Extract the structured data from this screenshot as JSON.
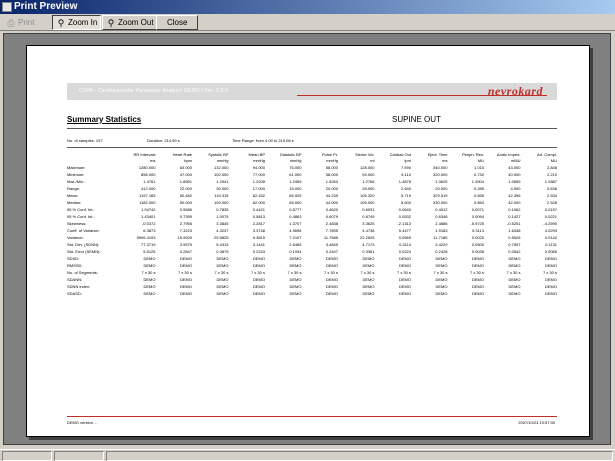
{
  "window": {
    "title": "Print Preview"
  },
  "toolbar": {
    "print_label": "Print",
    "zoom_in_label": "Zoom In",
    "zoom_out_label": "Zoom Out",
    "close_label": "Close"
  },
  "report": {
    "banner_title": "CVPA - Cardiovascular Parameter Analysis DEMO / Ver. 2.0.0",
    "logo_text": "nevrokard",
    "section_title": "Summary Statistics",
    "position_label": "SUPINE OUT",
    "samples_label": "No. of samples:",
    "samples_value": "197",
    "duration_label": "Duration:",
    "duration_value": "214.99 s",
    "time_range_label": "Time Range:",
    "time_range_value": "from 4.09 to 219.08 s",
    "footer_left": "DEMO version ...",
    "footer_right": "2007/10/23 19:57:30",
    "columns": [
      {
        "name": "RR Intervals",
        "unit": "ms"
      },
      {
        "name": "Heart Rate",
        "unit": "bpm"
      },
      {
        "name": "Systolic BP",
        "unit": "mmHg"
      },
      {
        "name": "Mean BP",
        "unit": "mmHg"
      },
      {
        "name": "Diastolic BP",
        "unit": "mmHg"
      },
      {
        "name": "Pulse Pr.",
        "unit": "mmHg"
      },
      {
        "name": "Stroke Vol.",
        "unit": "ml"
      },
      {
        "name": "Cardiac Out",
        "unit": "lpm"
      },
      {
        "name": "Eject. Time",
        "unit": "ms"
      },
      {
        "name": "Periph. Res.",
        "unit": "MU"
      },
      {
        "name": "Aortic Imped.",
        "unit": "mMU"
      },
      {
        "name": "Art. Compl.",
        "unit": "MU"
      }
    ],
    "rows": [
      {
        "label": "Maximum:",
        "values": [
          "1280.000",
          "83.000",
          "132.000",
          "94.000",
          "76.000",
          "58.000",
          "128.000",
          "7.590",
          "340.000",
          "1.015",
          "43.000",
          "2.848"
        ]
      },
      {
        "label": "Minimum:",
        "values": [
          "856.000",
          "47.000",
          "102.000",
          "77.000",
          "61.000",
          "38.000",
          "94.000",
          "5.110",
          "320.000",
          "0.730",
          "40.000",
          "2.210"
        ]
      },
      {
        "label": "Max./Min.:",
        "values": [
          "1.4761",
          "1.8951",
          "1.2941",
          "1.2208",
          "1.2459",
          "1.5263",
          "1.2766",
          "1.4878",
          "1.0625",
          "1.3904",
          "1.0659",
          "1.2887"
        ]
      },
      {
        "label": "Range:",
        "values": [
          "412.000",
          "22.000",
          "30.000",
          "17.000",
          "15.000",
          "20.000",
          "28.000",
          "2.640",
          "20.000",
          "0.285",
          "4.000",
          "0.638"
        ]
      },
      {
        "label": "Mean:",
        "values": [
          "1197.165",
          "50.482",
          "119.315",
          "82.432",
          "65.925",
          "44.239",
          "105.320",
          "5.719",
          "329.519",
          "0.855",
          "42.396",
          "2.534"
        ]
      },
      {
        "label": "Median:",
        "values": [
          "1182.000",
          "50.000",
          "109.000",
          "82.000",
          "65.000",
          "44.000",
          "105.000",
          "5.600",
          "330.000",
          "0.854",
          "42.000",
          "2.528"
        ]
      },
      {
        "label": "95 % Conf. Int.:",
        "values": [
          "1.94742",
          "0.5586",
          "0.7835",
          "0.4421",
          "0.5777",
          "0.4620",
          "0.6031",
          "0.0640",
          "0.4012",
          "0.0071",
          "0.1062",
          "0.0157"
        ]
      },
      {
        "label": "95 % Conf. Int.:",
        "values": [
          "1.43401",
          "0.7395",
          "1.0075",
          "0.5813",
          "0.4863",
          "0.6079",
          "0.8749",
          "0.0532",
          "0.6348",
          "0.0094",
          "0.1427",
          "0.0221"
        ]
      },
      {
        "label": "Skewness:",
        "values": [
          "-0.0372",
          "2.7955",
          "3.3845",
          "2.2817",
          "1.3707",
          "2.4838",
          "3.3625",
          "-2.1313",
          "2.4686",
          "-5.9725",
          "-0.5251",
          "-4.2590"
        ]
      },
      {
        "label": "Coeff. of Variance:",
        "values": [
          "6.3873",
          "7.3223",
          "4.3237",
          "3.3748",
          "4.9696",
          "7.7895",
          "4.4738",
          "5.4477",
          "1.9183",
          "5.3113",
          "1.6348",
          "4.0293"
        ]
      },
      {
        "label": "Variance:",
        "values": [
          "5906.4193",
          "15.9929",
          "29.5825",
          "9.3815",
          "7.2107",
          "11.7585",
          "22.2525",
          "0.0565",
          "11.7185",
          "0.0025",
          "0.5526",
          "0.0142"
        ]
      },
      {
        "label": "Std. Dev. (SDNN):",
        "values": [
          "77.3719",
          "3.9575",
          "5.4315",
          "3.1441",
          "2.6465",
          "3.4849",
          "4.7173",
          "0.3114",
          "3.4229",
          "0.0500",
          "0.7597",
          "0.1131"
        ]
      },
      {
        "label": "Std. Error (SEMN):",
        "values": [
          "5.5125",
          "0.2847",
          "0.3879",
          "0.2243",
          "0.1934",
          "0.2447",
          "0.3361",
          "0.0224",
          "0.2428",
          "0.0036",
          "0.0542",
          "0.0085"
        ]
      },
      {
        "label": "SDSD:",
        "values": [
          "DEMO",
          "DEMO",
          "DEMO",
          "DEMO",
          "DEMO",
          "DEMO",
          "DEMO",
          "DEMO",
          "DEMO",
          "DEMO",
          "DEMO",
          "DEMO"
        ]
      },
      {
        "label": "RMSSD:",
        "values": [
          "DEMO",
          "DEMO",
          "DEMO",
          "DEMO",
          "DEMO",
          "DEMO",
          "DEMO",
          "DEMO",
          "DEMO",
          "DEMO",
          "DEMO",
          "DEMO"
        ]
      },
      {
        "label": "No. of Segments:",
        "values": [
          "7 x 30 s",
          "7 x 30 s",
          "7 x 30 s",
          "7 x 30 s",
          "7 x 30 s",
          "7 x 30 s",
          "7 x 30 s",
          "7 x 30 s",
          "7 x 30 s",
          "7 x 30 s",
          "7 x 30 s",
          "7 x 30 s"
        ]
      },
      {
        "label": "SDANN:",
        "values": [
          "DEMO",
          "DEMO",
          "DEMO",
          "DEMO",
          "DEMO",
          "DEMO",
          "DEMO",
          "DEMO",
          "DEMO",
          "DEMO",
          "DEMO",
          "DEMO"
        ]
      },
      {
        "label": "SDNN index:",
        "values": [
          "DEMO",
          "DEMO",
          "DEMO",
          "DEMO",
          "DEMO",
          "DEMO",
          "DEMO",
          "DEMO",
          "DEMO",
          "DEMO",
          "DEMO",
          "DEMO"
        ]
      },
      {
        "label": "SDASD:",
        "values": [
          "DEMO",
          "DEMO",
          "DEMO",
          "DEMO",
          "DEMO",
          "DEMO",
          "DEMO",
          "DEMO",
          "DEMO",
          "DEMO",
          "DEMO",
          "DEMO"
        ]
      }
    ]
  }
}
